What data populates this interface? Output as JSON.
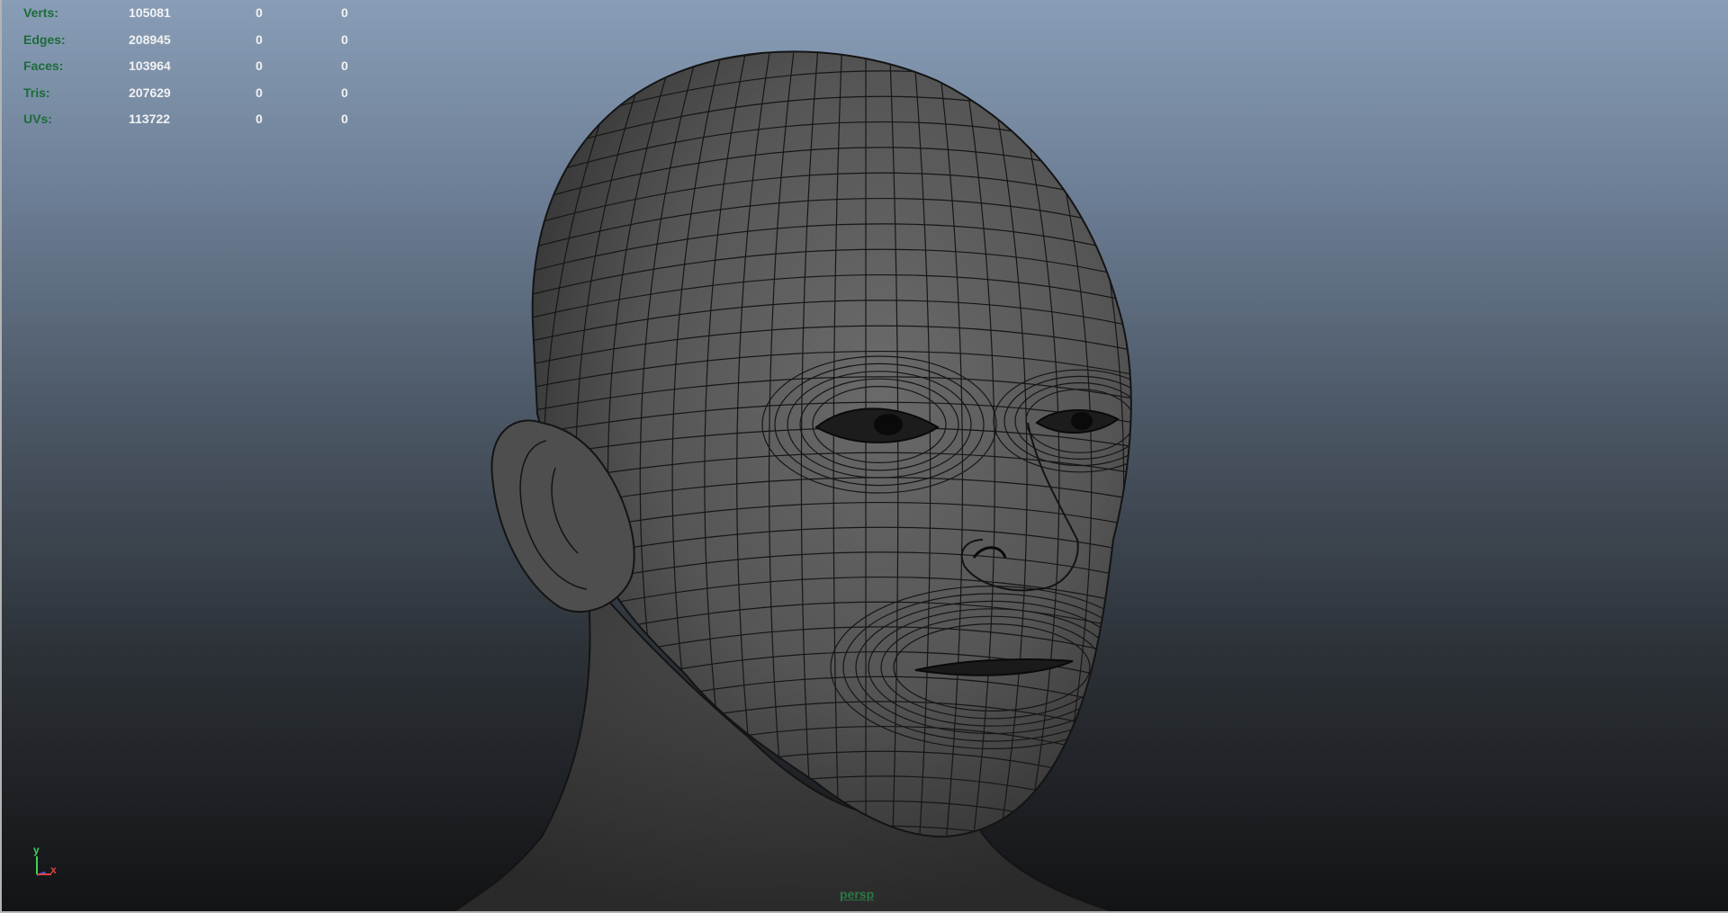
{
  "hud": {
    "rows": [
      {
        "label": "Verts:",
        "total": "105081",
        "selected": "0",
        "component": "0"
      },
      {
        "label": "Edges:",
        "total": "208945",
        "selected": "0",
        "component": "0"
      },
      {
        "label": "Faces:",
        "total": "103964",
        "selected": "0",
        "component": "0"
      },
      {
        "label": "Tris:",
        "total": "207629",
        "selected": "0",
        "component": "0"
      },
      {
        "label": "UVs:",
        "total": "113722",
        "selected": "0",
        "component": "0"
      }
    ]
  },
  "axis": {
    "y_label": "y",
    "x_label": "x"
  },
  "camera": {
    "name": "persp"
  },
  "colors": {
    "hud_label": "#1d6b3a",
    "hud_value": "#f2f2f2",
    "mesh_fill": "#565656",
    "mesh_wire": "#141414",
    "axis_y": "#3fd35a",
    "axis_x": "#e04343",
    "axis_z": "#3a5bd8"
  },
  "icons": {
    "axis_indicator": "xyz-axis-icon",
    "model": "wireframe-head"
  }
}
